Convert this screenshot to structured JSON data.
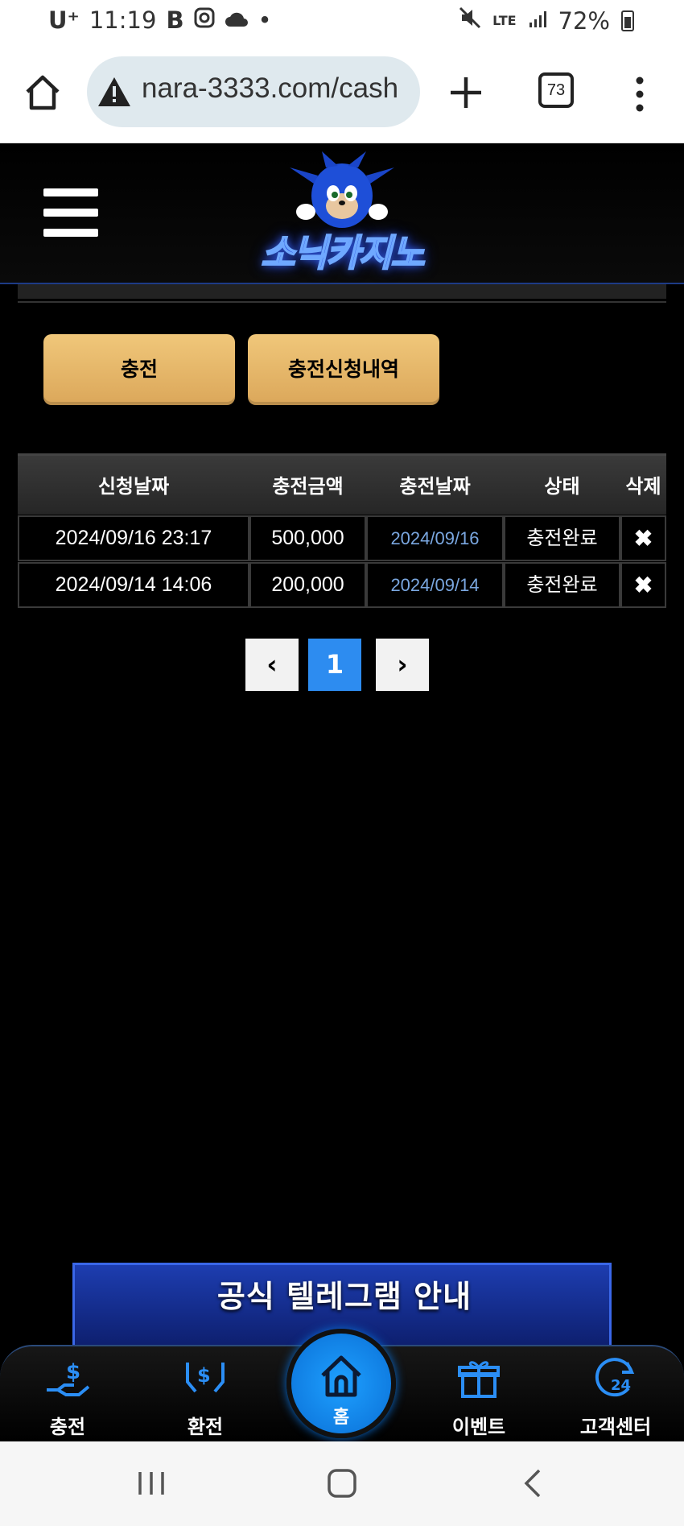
{
  "status_bar": {
    "carrier": "U⁺",
    "time": "11:19",
    "network": "LTE",
    "battery": "72%"
  },
  "browser": {
    "url": "nara-3333.com/cash",
    "tab_count": "73"
  },
  "site": {
    "logo_text": "소닉카지노"
  },
  "actions": {
    "charge_label": "충전",
    "history_label": "충전신청내역"
  },
  "table": {
    "headers": [
      "신청날짜",
      "충전금액",
      "충전날짜",
      "상태",
      "삭제"
    ],
    "rows": [
      {
        "request_date": "2024/09/16 23:17",
        "amount": "500,000",
        "charge_date": "2024/09/16",
        "status": "충전완료",
        "delete": "✖"
      },
      {
        "request_date": "2024/09/14 14:06",
        "amount": "200,000",
        "charge_date": "2024/09/14",
        "status": "충전완료",
        "delete": "✖"
      }
    ]
  },
  "pagination": {
    "prev": "‹",
    "current": "1",
    "next": "›"
  },
  "banner": {
    "telegram_title": "공식 텔레그램 안내"
  },
  "bottom_nav": {
    "charge": "충전",
    "exchange": "환전",
    "home": "홈",
    "event": "이벤트",
    "customer_center": "고객센터"
  },
  "colors": {
    "accent_gold": "#e3b163",
    "page_active": "#2d8cf0",
    "nav_home": "#1a8cf0",
    "date_link": "#7aa7e0"
  }
}
